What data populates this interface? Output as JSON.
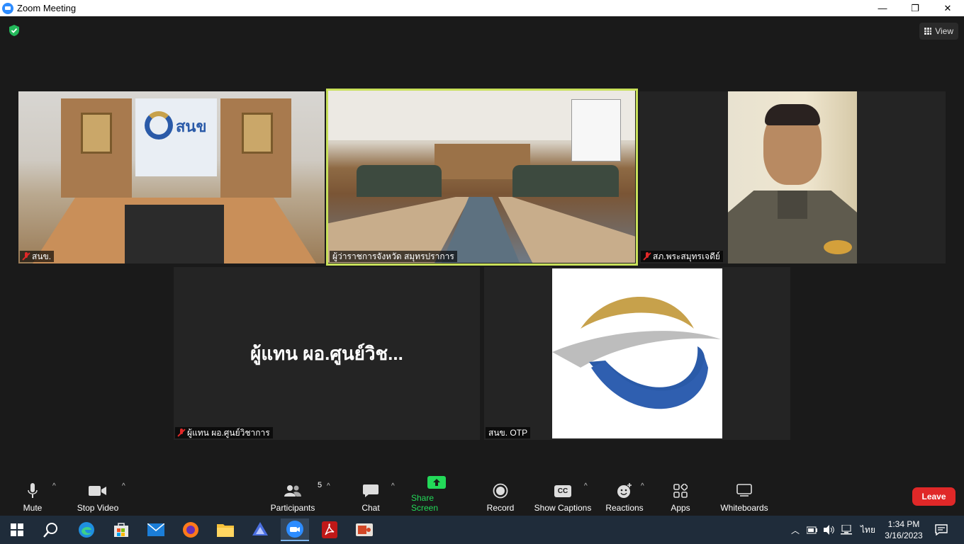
{
  "window": {
    "title": "Zoom Meeting",
    "minimize": "—",
    "restore": "❐",
    "close": "✕"
  },
  "topbar": {
    "view_label": "View"
  },
  "tiles": {
    "room1_name": "สนข.",
    "room1_logo_text": "สนข",
    "room2_name": "ผู้ว่าราชการจังหวัด สมุทรปราการ",
    "man_name": "สภ.พระสมุทรเจดีย์",
    "name_tile_display": "ผู้แทน ผอ.ศูนย์วิช...",
    "name_tile_name": "ผู้แทน ผอ.ศูนย์วิชาการ",
    "otp_name": "สนข. OTP"
  },
  "toolbar": {
    "mute": "Mute",
    "stop_video": "Stop Video",
    "participants": "Participants",
    "participants_count": "5",
    "chat": "Chat",
    "share_screen": "Share Screen",
    "record": "Record",
    "show_captions": "Show Captions",
    "cc_badge": "CC",
    "reactions": "Reactions",
    "apps": "Apps",
    "whiteboards": "Whiteboards",
    "leave": "Leave",
    "caret": "^"
  },
  "taskbar": {
    "language": "ไทย",
    "time": "1:34 PM",
    "date": "3/16/2023"
  },
  "colors": {
    "accent": "#2d8cff",
    "active_speaker": "#c8e05a",
    "share_green": "#23d959",
    "leave_red": "#e02828"
  }
}
